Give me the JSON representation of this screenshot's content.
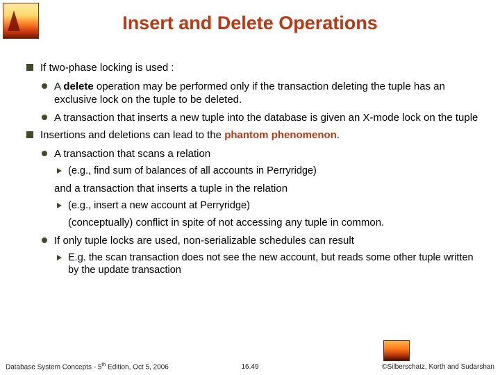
{
  "title": "Insert and Delete Operations",
  "b1": "If two-phase locking is used :",
  "b1a_pre": "A ",
  "b1a_bold": "delete",
  "b1a_post": " operation may be performed only if the transaction deleting the tuple has an exclusive lock on the tuple to be deleted.",
  "b1b": "A transaction that inserts a new tuple into the database is given an X-mode lock on the tuple",
  "b2_pre": "Insertions and deletions can lead to the ",
  "b2_red": "phantom phenomenon",
  "b2_post": ".",
  "b2a": "A transaction that scans a relation",
  "b2a1": "(e.g., find sum of balances of all accounts in Perryridge)",
  "b2a_mid": "and a transaction that inserts a tuple in the relation",
  "b2a2": "(e.g., insert a new account at Perryridge)",
  "b2a_end": "(conceptually) conflict in spite of not accessing any tuple in common.",
  "b2b": "If only tuple locks are used, non-serializable schedules can result",
  "b2b1": "E.g. the scan transaction does not see the new account, but reads some other tuple written by the update transaction",
  "footer_left_pre": "Database System Concepts - 5",
  "footer_left_sup": "th",
  "footer_left_post": " Edition, Oct 5, 2006",
  "footer_center": "16.49",
  "footer_right": "©Silberschatz, Korth and Sudarshan"
}
